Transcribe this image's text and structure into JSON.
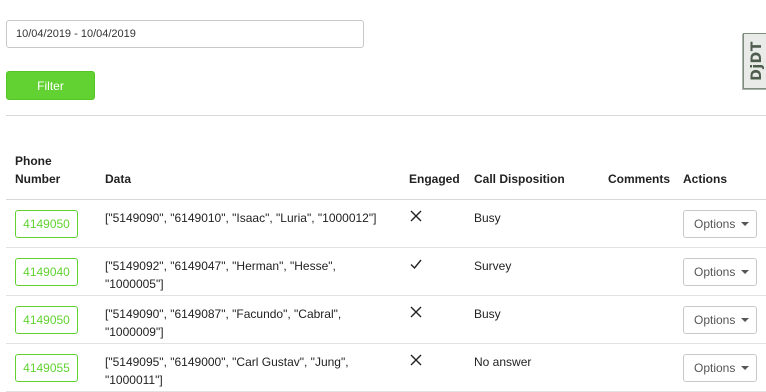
{
  "filters": {
    "date_range": "10/04/2019 - 10/04/2019",
    "filter_label": "Filter"
  },
  "debug_toolbar": {
    "label": "DjDT"
  },
  "table": {
    "headers": {
      "phone_line1": "Phone",
      "phone_line2": "Number",
      "data": "Data",
      "engaged": "Engaged",
      "call_disposition": "Call Disposition",
      "comments": "Comments",
      "actions": "Actions"
    },
    "rows": [
      {
        "phone": "4149050",
        "data": "[\"5149090\", \"6149010\", \"Isaac\", \"Luria\", \"1000012\"]",
        "engaged": "cross",
        "disposition": "Busy",
        "comments": "",
        "action_label": "Options"
      },
      {
        "phone": "4149040",
        "data": "[\"5149092\", \"6149047\", \"Herman\", \"Hesse\", \"1000005\"]",
        "engaged": "check",
        "disposition": "Survey",
        "comments": "",
        "action_label": "Options"
      },
      {
        "phone": "4149050",
        "data": "[\"5149090\", \"6149087\", \"Facundo\", \"Cabral\", \"1000009\"]",
        "engaged": "cross",
        "disposition": "Busy",
        "comments": "",
        "action_label": "Options"
      },
      {
        "phone": "4149055",
        "data": "[\"5149095\", \"6149000\", \"Carl Gustav\", \"Jung\", \"1000011\"]",
        "engaged": "cross",
        "disposition": "No answer",
        "comments": "",
        "action_label": "Options"
      }
    ]
  },
  "colors": {
    "accent": "#62d232",
    "border": "#c8c8c8",
    "divider": "#d7d7d7"
  }
}
